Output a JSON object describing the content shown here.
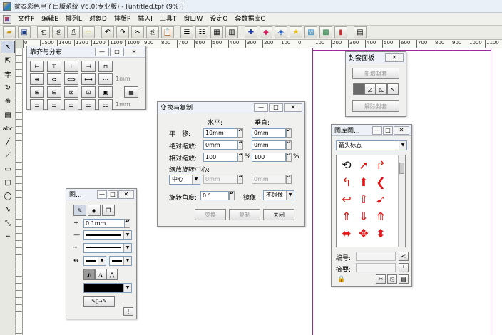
{
  "window": {
    "title": "蒙泰彩色电子出版系统 V6.0(专业版) - [untitled.tpf (9%)]"
  },
  "menu": [
    "文件F",
    "编辑E",
    "排列L",
    "对象D",
    "排版P",
    "插入I",
    "工具T",
    "窗口W",
    "设定O",
    "套数据库C"
  ],
  "toolbar_icons": [
    "open-folder-icon",
    "save-icon",
    "import-icon",
    "export-icon",
    "print-icon",
    "print-preview-icon",
    "undo-icon",
    "redo-icon",
    "cut-icon",
    "copy-icon",
    "paste-icon",
    "align-left-icon",
    "align-center-icon",
    "table-icon",
    "grid-icon",
    "crosshair-icon",
    "color-fill-icon",
    "color-palette-icon",
    "star-icon",
    "map-icon",
    "image-icon",
    "chart-icon",
    "document-icon"
  ],
  "ruler_ticks": [
    "0",
    "1500",
    "1400",
    "1300",
    "1200",
    "1100",
    "1000",
    "900",
    "800",
    "700",
    "600",
    "500",
    "400",
    "300",
    "200",
    "100",
    "0",
    "100",
    "200",
    "300",
    "400",
    "500",
    "600",
    "700",
    "800",
    "900",
    "1000",
    "1100"
  ],
  "tools": [
    {
      "icon": "arrow-select-icon",
      "glyph": "↖"
    },
    {
      "icon": "node-select-icon",
      "glyph": "⇱"
    },
    {
      "icon": "text-tool-icon",
      "glyph": "字"
    },
    {
      "icon": "rotate-icon",
      "glyph": "↻"
    },
    {
      "icon": "zoom-icon",
      "glyph": "⊕"
    },
    {
      "icon": "page-icon",
      "glyph": "▤"
    },
    {
      "icon": "text-frame-icon",
      "glyph": "abc"
    },
    {
      "icon": "line-tool-icon",
      "glyph": "╱"
    },
    {
      "icon": "diagonal-line-icon",
      "glyph": "⟋"
    },
    {
      "icon": "rectangle-icon",
      "glyph": "▭"
    },
    {
      "icon": "rounded-rect-icon",
      "glyph": "▢"
    },
    {
      "icon": "ellipse-icon",
      "glyph": "◯"
    },
    {
      "icon": "curve-icon",
      "glyph": "∿"
    },
    {
      "icon": "polyline-icon",
      "glyph": "⤡"
    },
    {
      "icon": "dashed-line-icon",
      "glyph": "┅"
    }
  ],
  "align_panel": {
    "title": "靠齐与分布",
    "spacing_label_1": "1mm",
    "spacing_label_2": "1mm"
  },
  "envelope_panel": {
    "title": "封套面板",
    "add_button": "新增封套",
    "remove_button": "解除封套"
  },
  "transform_dialog": {
    "title": "变换与复制",
    "horizontal_header": "水平:",
    "vertical_header": "垂直:",
    "rows": [
      {
        "label": "平　移:",
        "h": "10mm",
        "v": "0mm",
        "unit": ""
      },
      {
        "label": "绝对缩放:",
        "h": "0mm",
        "v": "0mm",
        "unit": ""
      },
      {
        "label": "相对缩放:",
        "h": "100",
        "v": "100",
        "unit": "%"
      }
    ],
    "pivot_label": "缩放旋转中心:",
    "pivot_value": "中心",
    "pivot_h": "0mm",
    "pivot_v": "0mm",
    "rotate_label": "旋转角度:",
    "rotate_value": "0 °",
    "mirror_label": "镜像:",
    "mirror_value": "不镜像",
    "btn_transform": "变换",
    "btn_copy": "复制",
    "btn_close": "关闭"
  },
  "line_panel": {
    "title": "图...",
    "width_value": "0.1mm"
  },
  "gallery_panel": {
    "title": "图库图...",
    "category": "箭头标志",
    "number_label": "编号:",
    "summary_label": "摘要:"
  },
  "colors": {
    "accent_red": "#e21818",
    "page_border": "#9a2a9a"
  }
}
